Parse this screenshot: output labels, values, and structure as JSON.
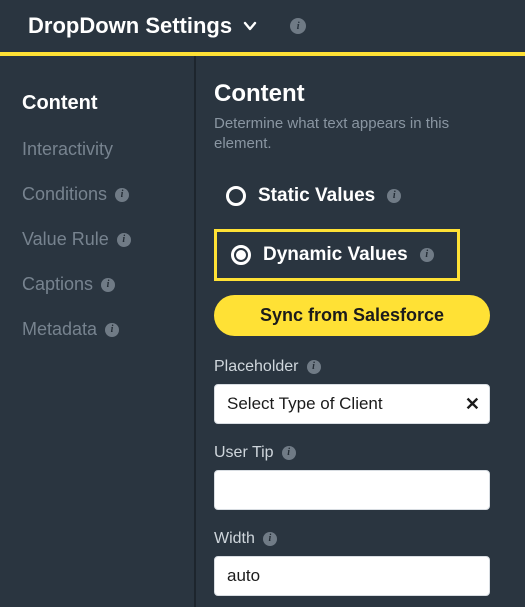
{
  "header": {
    "title": "DropDown Settings"
  },
  "sidebar": {
    "items": [
      {
        "label": "Content",
        "has_info": false,
        "active": true
      },
      {
        "label": "Interactivity",
        "has_info": false,
        "active": false
      },
      {
        "label": "Conditions",
        "has_info": true,
        "active": false
      },
      {
        "label": "Value Rule",
        "has_info": true,
        "active": false
      },
      {
        "label": "Captions",
        "has_info": true,
        "active": false
      },
      {
        "label": "Metadata",
        "has_info": true,
        "active": false
      }
    ]
  },
  "content": {
    "title": "Content",
    "description": "Determine what text appears in this element.",
    "radios": {
      "static_label": "Static Values",
      "dynamic_label": "Dynamic Values",
      "selected": "dynamic"
    },
    "sync_button_label": "Sync from Salesforce",
    "fields": {
      "placeholder": {
        "label": "Placeholder",
        "value": "Select Type of Client"
      },
      "user_tip": {
        "label": "User Tip",
        "value": ""
      },
      "width": {
        "label": "Width",
        "value": "auto"
      }
    }
  }
}
